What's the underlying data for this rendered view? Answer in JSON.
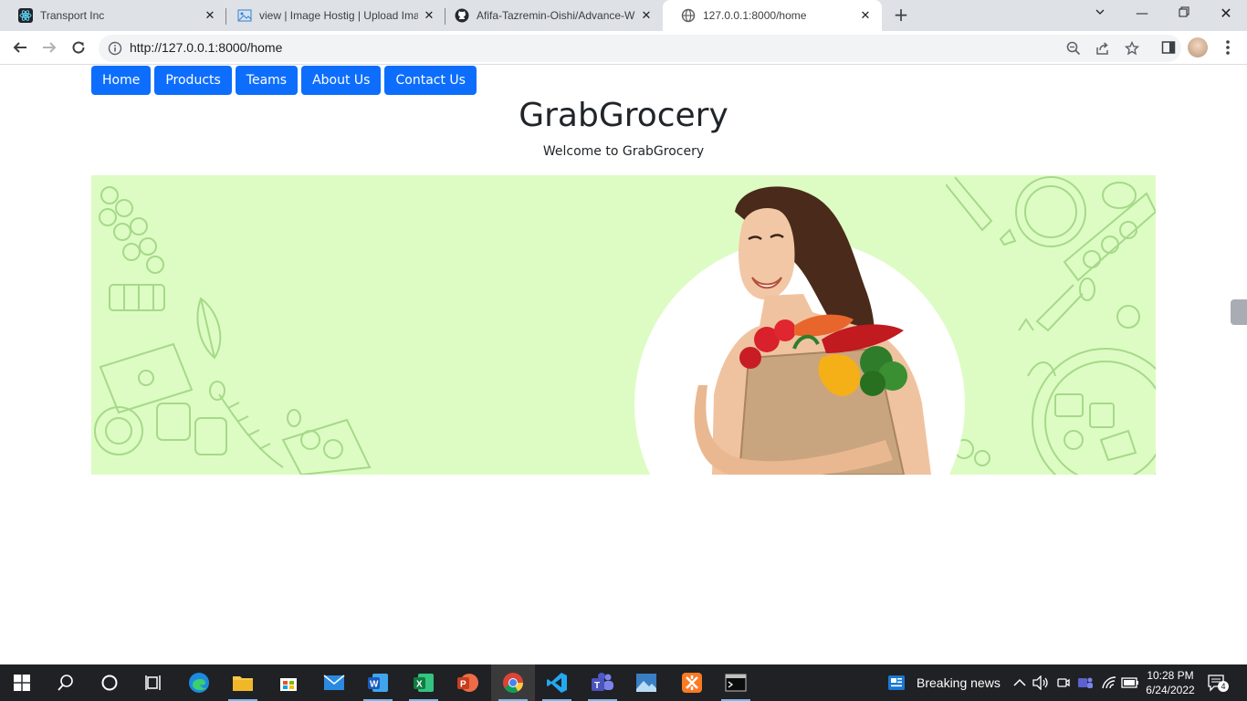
{
  "browser": {
    "tabs": [
      {
        "title": "Transport Inc",
        "icon": "react-icon"
      },
      {
        "title": "view | Image Hostig | Upload Ima",
        "icon": "image-host-icon"
      },
      {
        "title": "Afifa-Tazremin-Oishi/Advance-W",
        "icon": "github-icon"
      },
      {
        "title": "127.0.0.1:8000/home",
        "icon": "globe-icon",
        "active": true
      }
    ],
    "url": "http://127.0.0.1:8000/home"
  },
  "nav": {
    "items": [
      "Home",
      "Products",
      "Teams",
      "About Us",
      "Contact Us"
    ]
  },
  "page": {
    "title": "GrabGrocery",
    "subtitle": "Welcome to GrabGrocery"
  },
  "colors": {
    "nav_button": "#0d6efd",
    "banner_bg": "#ddfcc3",
    "taskbar": "#202124"
  },
  "taskbar": {
    "apps": [
      "windows-start-icon",
      "search-icon",
      "cortana-icon",
      "task-view-icon",
      "edge-icon",
      "file-explorer-icon",
      "store-icon",
      "mail-icon",
      "word-icon",
      "excel-icon",
      "powerpoint-icon",
      "chrome-icon",
      "vscode-icon",
      "teams-icon",
      "photos-icon",
      "xampp-icon",
      "terminal-icon"
    ],
    "news": "Breaking news",
    "time": "10:28 PM",
    "date": "6/24/2022",
    "notifications": "4"
  }
}
